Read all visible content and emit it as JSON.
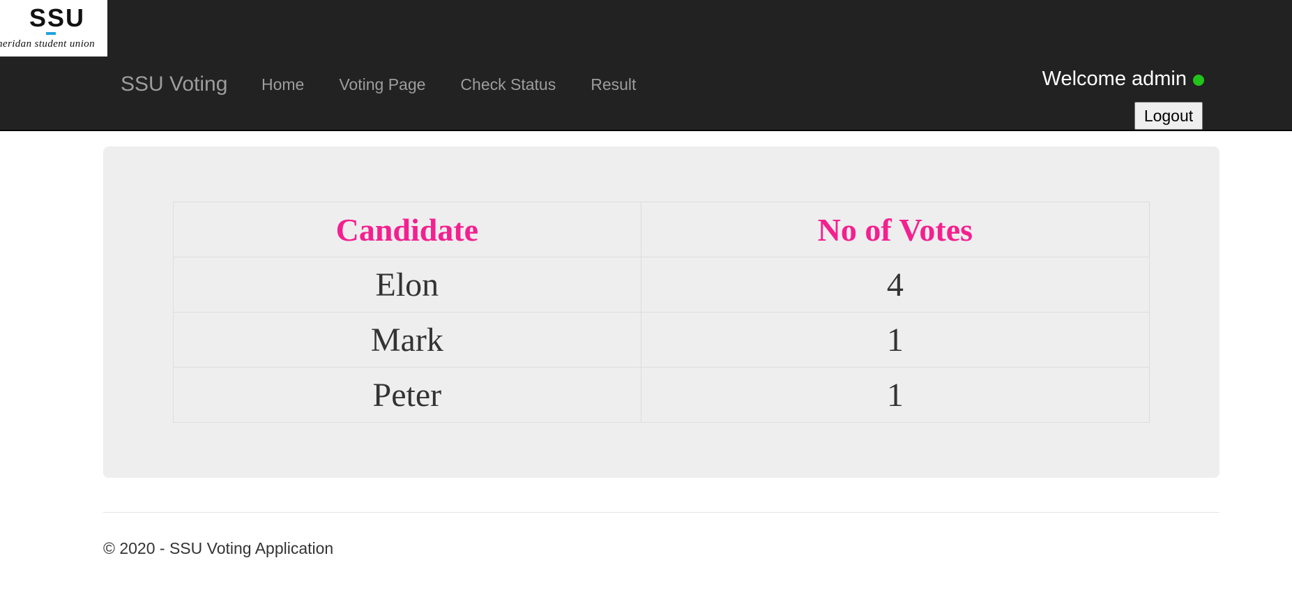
{
  "logo": {
    "mark": "SSU",
    "subtitle": "heridan student union"
  },
  "nav": {
    "brand": "SSU Voting",
    "links": [
      {
        "label": "Home"
      },
      {
        "label": "Voting Page"
      },
      {
        "label": "Check Status"
      },
      {
        "label": "Result"
      }
    ]
  },
  "user": {
    "welcome": "Welcome admin",
    "status_color": "#22c31a",
    "logout_label": "Logout"
  },
  "results": {
    "headers": {
      "candidate": "Candidate",
      "votes": "No of Votes"
    },
    "rows": [
      {
        "candidate": "Elon",
        "votes": "4"
      },
      {
        "candidate": "Mark",
        "votes": "1"
      },
      {
        "candidate": "Peter",
        "votes": "1"
      }
    ],
    "header_color": "#f4208f"
  },
  "footer": {
    "text": "© 2020 - SSU Voting Application"
  }
}
